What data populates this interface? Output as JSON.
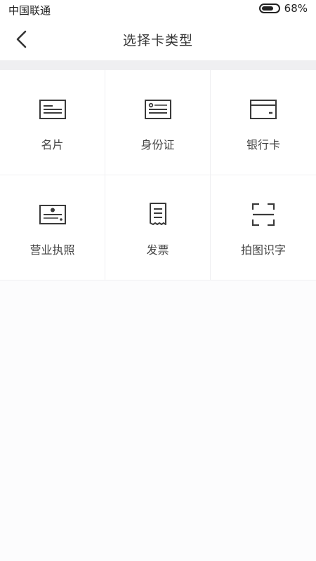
{
  "status_bar": {
    "carrier": "中国联通",
    "battery_percent": "68%"
  },
  "nav": {
    "back_icon": "chevron-left-icon",
    "title": "选择卡类型"
  },
  "card_types": [
    {
      "label": "名片",
      "icon": "business-card-icon"
    },
    {
      "label": "身份证",
      "icon": "id-card-icon"
    },
    {
      "label": "银行卡",
      "icon": "bank-card-icon"
    },
    {
      "label": "营业执照",
      "icon": "business-license-icon"
    },
    {
      "label": "发票",
      "icon": "invoice-icon"
    },
    {
      "label": "拍图识字",
      "icon": "scan-text-icon"
    }
  ],
  "colors": {
    "divider": "#efeff1",
    "icon_stroke": "#3a3a3a",
    "text": "#444444"
  }
}
